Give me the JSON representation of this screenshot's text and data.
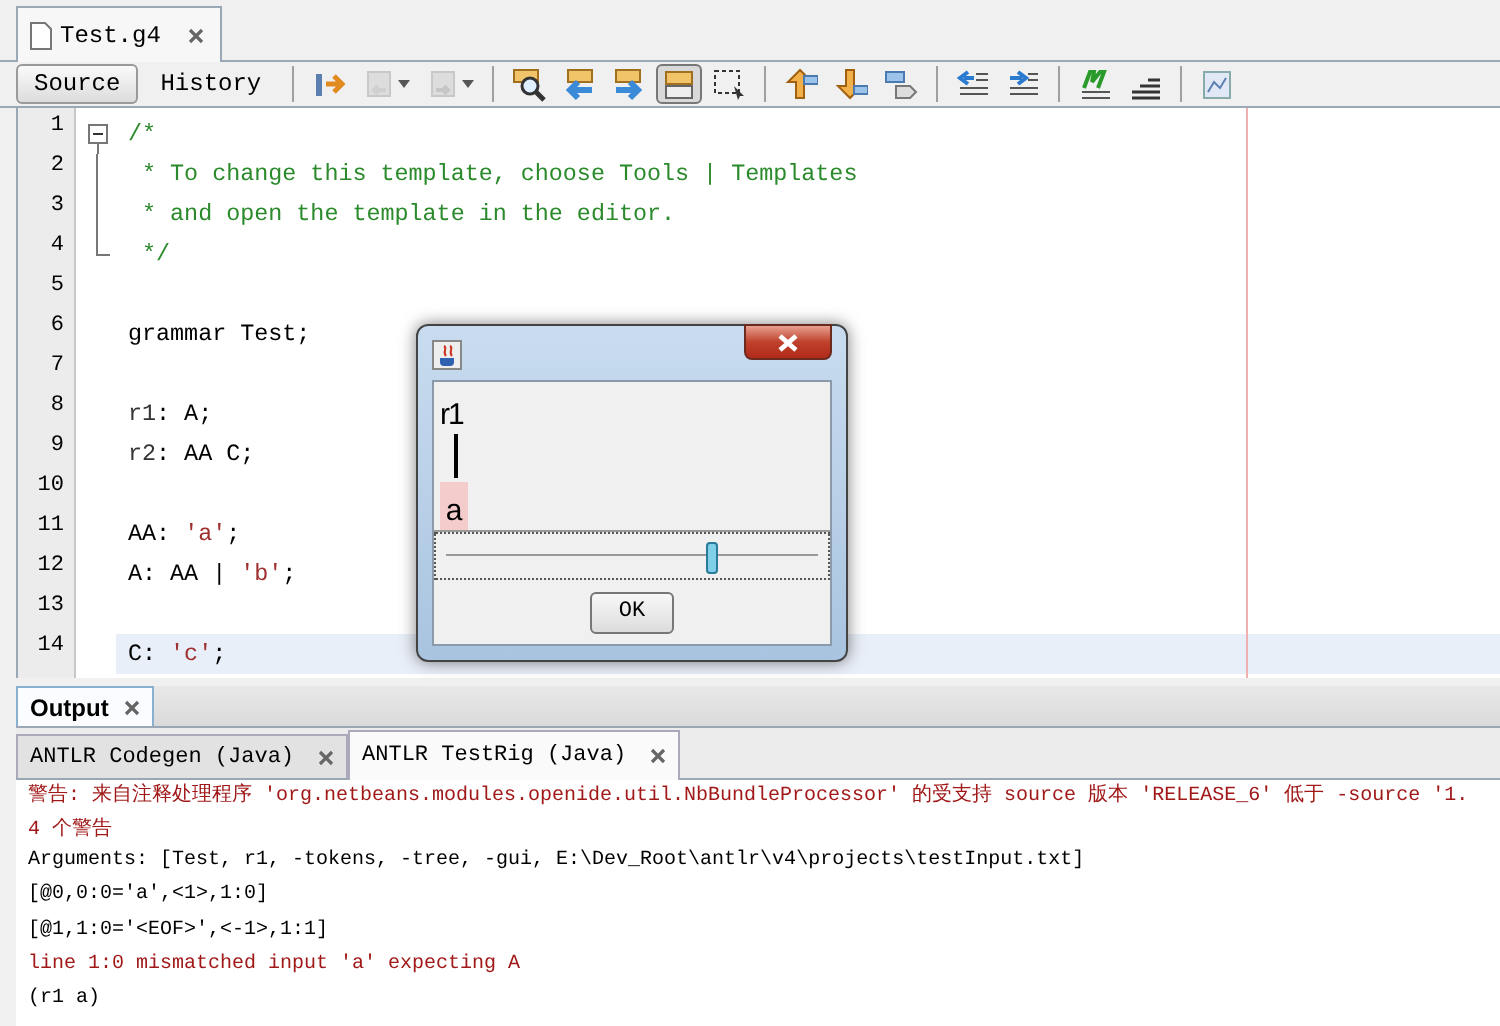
{
  "editor_tabs": [
    {
      "label": "Test.g4",
      "selected": true
    }
  ],
  "view_buttons": [
    {
      "label": "Source",
      "selected": true
    },
    {
      "label": "History",
      "selected": false
    }
  ],
  "toolbar_groups": [
    [
      {
        "kind": "last-edit",
        "disabled": false,
        "selected": false
      },
      {
        "kind": "prev-bookmark",
        "disabled": true,
        "selected": false
      },
      {
        "kind": "next-bookmark",
        "disabled": true,
        "selected": false
      }
    ],
    [
      {
        "kind": "find",
        "disabled": false,
        "selected": false
      },
      {
        "kind": "find-prev",
        "disabled": false,
        "selected": false
      },
      {
        "kind": "find-next",
        "disabled": false,
        "selected": false
      },
      {
        "kind": "highlight",
        "disabled": false,
        "selected": true
      },
      {
        "kind": "rect-select",
        "disabled": false,
        "selected": false
      }
    ],
    [
      {
        "kind": "prev-occurrence",
        "disabled": false,
        "selected": false
      },
      {
        "kind": "next-occurrence",
        "disabled": false,
        "selected": false
      },
      {
        "kind": "toggle-bookmark",
        "disabled": false,
        "selected": false
      }
    ],
    [
      {
        "kind": "shift-left",
        "disabled": false,
        "selected": false
      },
      {
        "kind": "shift-right",
        "disabled": false,
        "selected": false
      }
    ],
    [
      {
        "kind": "macro",
        "disabled": false,
        "selected": false
      },
      {
        "kind": "stop-macro",
        "disabled": false,
        "selected": false
      }
    ],
    [
      {
        "kind": "diagram",
        "disabled": false,
        "selected": false
      }
    ]
  ],
  "code_lines": [
    {
      "number": "1",
      "kind": "fold-start",
      "current": false,
      "segments": [
        {
          "kind": "comment",
          "text": "/*"
        }
      ]
    },
    {
      "number": "2",
      "kind": "fold-body",
      "current": false,
      "segments": [
        {
          "kind": "comment",
          "text": " * To change this template, choose Tools | Templates"
        }
      ]
    },
    {
      "number": "3",
      "kind": "fold-body",
      "current": false,
      "segments": [
        {
          "kind": "comment",
          "text": " * and open the template in the editor."
        }
      ]
    },
    {
      "number": "4",
      "kind": "fold-end",
      "current": false,
      "segments": [
        {
          "kind": "comment",
          "text": " */"
        }
      ]
    },
    {
      "number": "5",
      "kind": "plain",
      "current": false
    },
    {
      "number": "6",
      "kind": "plain",
      "current": false,
      "segments": [
        {
          "kind": "plain",
          "text": "grammar Test;"
        }
      ]
    },
    {
      "number": "7",
      "kind": "plain",
      "current": false
    },
    {
      "number": "8",
      "kind": "plain",
      "current": false,
      "segments": [
        {
          "kind": "rule",
          "text": "r1"
        },
        {
          "kind": "plain",
          "text": ": A;"
        }
      ]
    },
    {
      "number": "9",
      "kind": "plain",
      "current": false,
      "segments": [
        {
          "kind": "rule",
          "text": "r2"
        },
        {
          "kind": "plain",
          "text": ": AA C;"
        }
      ]
    },
    {
      "number": "10",
      "kind": "plain",
      "current": false
    },
    {
      "number": "11",
      "kind": "plain",
      "current": false,
      "segments": [
        {
          "kind": "plain",
          "text": "AA: "
        },
        {
          "kind": "string",
          "text": "'a'"
        },
        {
          "kind": "plain",
          "text": ";"
        }
      ]
    },
    {
      "number": "12",
      "kind": "plain",
      "current": false,
      "segments": [
        {
          "kind": "plain",
          "text": "A: AA | "
        },
        {
          "kind": "string",
          "text": "'b'"
        },
        {
          "kind": "plain",
          "text": ";"
        }
      ]
    },
    {
      "number": "13",
      "kind": "plain",
      "current": false
    },
    {
      "number": "14",
      "kind": "plain",
      "current": true,
      "segments": [
        {
          "kind": "plain",
          "text": "C: "
        },
        {
          "kind": "string",
          "text": "'c'"
        },
        {
          "kind": "plain",
          "text": ";"
        }
      ]
    }
  ],
  "dialog": {
    "tree_root": "r1",
    "tree_leaf": "a",
    "leaf_error": true,
    "zoom_slider": {
      "level": 0.71
    },
    "ok_button": "OK"
  },
  "output": {
    "title": "Output",
    "tabs": [
      {
        "label": "ANTLR Codegen (Java)",
        "selected": false
      },
      {
        "label": "ANTLR TestRig (Java)",
        "selected": true
      }
    ],
    "lines": [
      {
        "kind": "error",
        "text": "警告: 来自注释处理程序 'org.netbeans.modules.openide.util.NbBundleProcessor' 的受支持 source 版本 'RELEASE_6' 低于 -source '1."
      },
      {
        "kind": "error",
        "text": "4 个警告"
      },
      {
        "kind": "normal",
        "text": "Arguments: [Test, r1, -tokens, -tree, -gui, E:\\Dev_Root\\antlr\\v4\\projects\\testInput.txt]"
      },
      {
        "kind": "normal",
        "text": "[@0,0:0='a',<1>,1:0]"
      },
      {
        "kind": "normal",
        "text": "[@1,1:0='<EOF>',<-1>,1:1]"
      },
      {
        "kind": "error",
        "text": "line 1:0 mismatched input 'a' expecting A"
      },
      {
        "kind": "normal",
        "text": "(r1 a)"
      }
    ]
  }
}
